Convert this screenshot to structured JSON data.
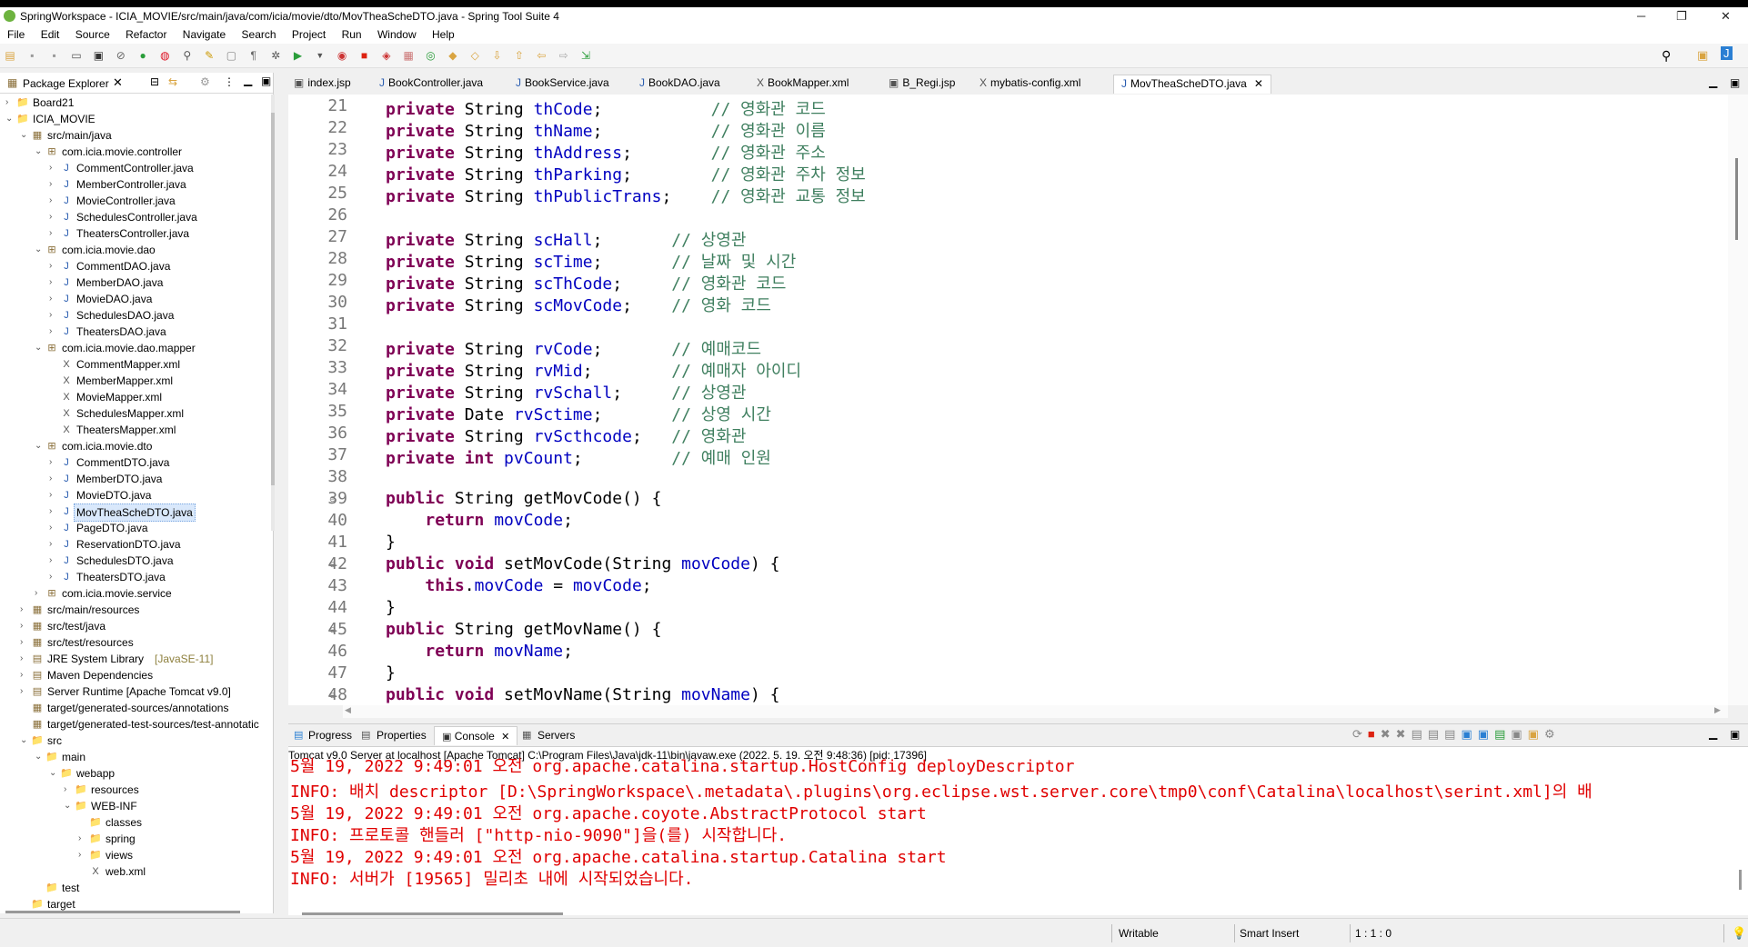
{
  "window": {
    "title": "SpringWorkspace - ICIA_MOVIE/src/main/java/com/icia/movie/dto/MovTheaScheDTO.java - Spring Tool Suite 4",
    "controls": [
      "─",
      "❐",
      "✕"
    ]
  },
  "menu": [
    "File",
    "Edit",
    "Source",
    "Refactor",
    "Navigate",
    "Search",
    "Project",
    "Run",
    "Window",
    "Help"
  ],
  "package_explorer": {
    "title": "Package Explorer",
    "tree": [
      {
        "indent": 0,
        "arrow": "›",
        "icon": "📁",
        "label": "Board21"
      },
      {
        "indent": 0,
        "arrow": "⌄",
        "icon": "📁",
        "label": "ICIA_MOVIE"
      },
      {
        "indent": 1,
        "arrow": "⌄",
        "icon": "▦",
        "label": "src/main/java"
      },
      {
        "indent": 2,
        "arrow": "⌄",
        "icon": "⊞",
        "label": "com.icia.movie.controller"
      },
      {
        "indent": 3,
        "arrow": "›",
        "icon": "J",
        "label": "CommentController.java"
      },
      {
        "indent": 3,
        "arrow": "›",
        "icon": "J",
        "label": "MemberController.java"
      },
      {
        "indent": 3,
        "arrow": "›",
        "icon": "J",
        "label": "MovieController.java"
      },
      {
        "indent": 3,
        "arrow": "›",
        "icon": "J",
        "label": "SchedulesController.java"
      },
      {
        "indent": 3,
        "arrow": "›",
        "icon": "J",
        "label": "TheatersController.java"
      },
      {
        "indent": 2,
        "arrow": "⌄",
        "icon": "⊞",
        "label": "com.icia.movie.dao"
      },
      {
        "indent": 3,
        "arrow": "›",
        "icon": "J",
        "label": "CommentDAO.java"
      },
      {
        "indent": 3,
        "arrow": "›",
        "icon": "J",
        "label": "MemberDAO.java"
      },
      {
        "indent": 3,
        "arrow": "›",
        "icon": "J",
        "label": "MovieDAO.java"
      },
      {
        "indent": 3,
        "arrow": "›",
        "icon": "J",
        "label": "SchedulesDAO.java"
      },
      {
        "indent": 3,
        "arrow": "›",
        "icon": "J",
        "label": "TheatersDAO.java"
      },
      {
        "indent": 2,
        "arrow": "⌄",
        "icon": "⊞",
        "label": "com.icia.movie.dao.mapper"
      },
      {
        "indent": 3,
        "arrow": "",
        "icon": "X",
        "label": "CommentMapper.xml"
      },
      {
        "indent": 3,
        "arrow": "",
        "icon": "X",
        "label": "MemberMapper.xml"
      },
      {
        "indent": 3,
        "arrow": "",
        "icon": "X",
        "label": "MovieMapper.xml"
      },
      {
        "indent": 3,
        "arrow": "",
        "icon": "X",
        "label": "SchedulesMapper.xml"
      },
      {
        "indent": 3,
        "arrow": "",
        "icon": "X",
        "label": "TheatersMapper.xml"
      },
      {
        "indent": 2,
        "arrow": "⌄",
        "icon": "⊞",
        "label": "com.icia.movie.dto"
      },
      {
        "indent": 3,
        "arrow": "›",
        "icon": "J",
        "label": "CommentDTO.java"
      },
      {
        "indent": 3,
        "arrow": "›",
        "icon": "J",
        "label": "MemberDTO.java"
      },
      {
        "indent": 3,
        "arrow": "›",
        "icon": "J",
        "label": "MovieDTO.java"
      },
      {
        "indent": 3,
        "arrow": "›",
        "icon": "J",
        "label": "MovTheaScheDTO.java",
        "selected": true
      },
      {
        "indent": 3,
        "arrow": "›",
        "icon": "J",
        "label": "PageDTO.java"
      },
      {
        "indent": 3,
        "arrow": "›",
        "icon": "J",
        "label": "ReservationDTO.java"
      },
      {
        "indent": 3,
        "arrow": "›",
        "icon": "J",
        "label": "SchedulesDTO.java"
      },
      {
        "indent": 3,
        "arrow": "›",
        "icon": "J",
        "label": "TheatersDTO.java"
      },
      {
        "indent": 2,
        "arrow": "›",
        "icon": "⊞",
        "label": "com.icia.movie.service"
      },
      {
        "indent": 1,
        "arrow": "›",
        "icon": "▦",
        "label": "src/main/resources"
      },
      {
        "indent": 1,
        "arrow": "›",
        "icon": "▦",
        "label": "src/test/java"
      },
      {
        "indent": 1,
        "arrow": "›",
        "icon": "▦",
        "label": "src/test/resources"
      },
      {
        "indent": 1,
        "arrow": "›",
        "icon": "▤",
        "label": "JRE System Library",
        "suffix": "[JavaSE-11]"
      },
      {
        "indent": 1,
        "arrow": "›",
        "icon": "▤",
        "label": "Maven Dependencies"
      },
      {
        "indent": 1,
        "arrow": "›",
        "icon": "▤",
        "label": "Server Runtime [Apache Tomcat v9.0]"
      },
      {
        "indent": 1,
        "arrow": "",
        "icon": "▦",
        "label": "target/generated-sources/annotations"
      },
      {
        "indent": 1,
        "arrow": "",
        "icon": "▦",
        "label": "target/generated-test-sources/test-annotatic"
      },
      {
        "indent": 1,
        "arrow": "⌄",
        "icon": "📁",
        "label": "src"
      },
      {
        "indent": 2,
        "arrow": "⌄",
        "icon": "📁",
        "label": "main"
      },
      {
        "indent": 3,
        "arrow": "⌄",
        "icon": "📁",
        "label": "webapp"
      },
      {
        "indent": 4,
        "arrow": "›",
        "icon": "📁",
        "label": "resources"
      },
      {
        "indent": 4,
        "arrow": "⌄",
        "icon": "📁",
        "label": "WEB-INF"
      },
      {
        "indent": 5,
        "arrow": "",
        "icon": "📁",
        "label": "classes"
      },
      {
        "indent": 5,
        "arrow": "›",
        "icon": "📁",
        "label": "spring"
      },
      {
        "indent": 5,
        "arrow": "›",
        "icon": "📁",
        "label": "views"
      },
      {
        "indent": 5,
        "arrow": "",
        "icon": "X",
        "label": "web.xml"
      },
      {
        "indent": 2,
        "arrow": "",
        "icon": "📁",
        "label": "test"
      },
      {
        "indent": 1,
        "arrow": "",
        "icon": "📁",
        "label": "target"
      }
    ]
  },
  "editor_tabs": [
    {
      "label": "index.jsp",
      "icon": "▣"
    },
    {
      "label": "BookController.java",
      "icon": "J"
    },
    {
      "label": "BookService.java",
      "icon": "J"
    },
    {
      "label": "BookDAO.java",
      "icon": "J"
    },
    {
      "label": "BookMapper.xml",
      "icon": "X"
    },
    {
      "label": "B_Regi.jsp",
      "icon": "▣"
    },
    {
      "label": "mybatis-config.xml",
      "icon": "X"
    },
    {
      "label": "MovTheaScheDTO.java",
      "icon": "J",
      "active": true
    }
  ],
  "code_lines": [
    {
      "n": "21",
      "segs": [
        [
          "kw",
          "private "
        ],
        [
          "",
          "String "
        ],
        [
          "fld",
          "thCode"
        ],
        [
          "",
          ";           "
        ],
        [
          "cmt",
          "// 영화관 코드"
        ]
      ]
    },
    {
      "n": "22",
      "segs": [
        [
          "kw",
          "private "
        ],
        [
          "",
          "String "
        ],
        [
          "fld",
          "thName"
        ],
        [
          "",
          ";           "
        ],
        [
          "cmt",
          "// 영화관 이름"
        ]
      ]
    },
    {
      "n": "23",
      "segs": [
        [
          "kw",
          "private "
        ],
        [
          "",
          "String "
        ],
        [
          "fld",
          "thAddress"
        ],
        [
          "",
          ";        "
        ],
        [
          "cmt",
          "// 영화관 주소"
        ]
      ]
    },
    {
      "n": "24",
      "segs": [
        [
          "kw",
          "private "
        ],
        [
          "",
          "String "
        ],
        [
          "fld",
          "thParking"
        ],
        [
          "",
          ";        "
        ],
        [
          "cmt",
          "// 영화관 주차 정보"
        ]
      ]
    },
    {
      "n": "25",
      "segs": [
        [
          "kw",
          "private "
        ],
        [
          "",
          "String "
        ],
        [
          "fld",
          "thPublicTrans"
        ],
        [
          "",
          ";    "
        ],
        [
          "cmt",
          "// 영화관 교통 정보"
        ]
      ]
    },
    {
      "n": "26",
      "segs": []
    },
    {
      "n": "27",
      "segs": [
        [
          "kw",
          "private "
        ],
        [
          "",
          "String "
        ],
        [
          "fld",
          "scHall"
        ],
        [
          "",
          ";       "
        ],
        [
          "cmt",
          "// 상영관"
        ]
      ]
    },
    {
      "n": "28",
      "segs": [
        [
          "kw",
          "private "
        ],
        [
          "",
          "String "
        ],
        [
          "fld",
          "scTime"
        ],
        [
          "",
          ";       "
        ],
        [
          "cmt",
          "// 날짜 및 시간"
        ]
      ]
    },
    {
      "n": "29",
      "segs": [
        [
          "kw",
          "private "
        ],
        [
          "",
          "String "
        ],
        [
          "fld",
          "scThCode"
        ],
        [
          "",
          ";     "
        ],
        [
          "cmt",
          "// 영화관 코드"
        ]
      ]
    },
    {
      "n": "30",
      "segs": [
        [
          "kw",
          "private "
        ],
        [
          "",
          "String "
        ],
        [
          "fld",
          "scMovCode"
        ],
        [
          "",
          ";    "
        ],
        [
          "cmt",
          "// 영화 코드"
        ]
      ]
    },
    {
      "n": "31",
      "segs": []
    },
    {
      "n": "32",
      "segs": [
        [
          "kw",
          "private "
        ],
        [
          "",
          "String "
        ],
        [
          "fld",
          "rvCode"
        ],
        [
          "",
          ";       "
        ],
        [
          "cmt",
          "// 예매코드"
        ]
      ]
    },
    {
      "n": "33",
      "segs": [
        [
          "kw",
          "private "
        ],
        [
          "",
          "String "
        ],
        [
          "fld",
          "rvMid"
        ],
        [
          "",
          ";        "
        ],
        [
          "cmt",
          "// 예매자 아이디"
        ]
      ]
    },
    {
      "n": "34",
      "segs": [
        [
          "kw",
          "private "
        ],
        [
          "",
          "String "
        ],
        [
          "fld",
          "rvSchall"
        ],
        [
          "",
          ";     "
        ],
        [
          "cmt",
          "// 상영관"
        ]
      ]
    },
    {
      "n": "35",
      "segs": [
        [
          "kw",
          "private "
        ],
        [
          "",
          "Date "
        ],
        [
          "fld",
          "rvSctime"
        ],
        [
          "",
          ";       "
        ],
        [
          "cmt",
          "// 상영 시간"
        ]
      ]
    },
    {
      "n": "36",
      "segs": [
        [
          "kw",
          "private "
        ],
        [
          "",
          "String "
        ],
        [
          "fld",
          "rvScthcode"
        ],
        [
          "",
          ";   "
        ],
        [
          "cmt",
          "// 영화관"
        ]
      ]
    },
    {
      "n": "37",
      "segs": [
        [
          "kw",
          "private int "
        ],
        [
          "fld",
          "pvCount"
        ],
        [
          "",
          ";         "
        ],
        [
          "cmt",
          "// 예매 인원"
        ]
      ]
    },
    {
      "n": "38",
      "segs": []
    },
    {
      "n": "39",
      "fold": true,
      "segs": [
        [
          "kw",
          "public "
        ],
        [
          "",
          "String getMovCode() {"
        ]
      ]
    },
    {
      "n": "40",
      "segs": [
        [
          "",
          "    "
        ],
        [
          "kw",
          "return "
        ],
        [
          "fld",
          "movCode"
        ],
        [
          "",
          ";"
        ]
      ]
    },
    {
      "n": "41",
      "segs": [
        [
          "",
          "}"
        ]
      ]
    },
    {
      "n": "42",
      "fold": true,
      "segs": [
        [
          "kw",
          "public void "
        ],
        [
          "",
          "setMovCode(String "
        ],
        [
          "fld",
          "movCode"
        ],
        [
          "",
          ") {"
        ]
      ]
    },
    {
      "n": "43",
      "segs": [
        [
          "",
          "    "
        ],
        [
          "kw",
          "this"
        ],
        [
          "",
          "."
        ],
        [
          "fld",
          "movCode"
        ],
        [
          "",
          " = "
        ],
        [
          "fld",
          "movCode"
        ],
        [
          "",
          ";"
        ]
      ]
    },
    {
      "n": "44",
      "segs": [
        [
          "",
          "}"
        ]
      ]
    },
    {
      "n": "45",
      "fold": true,
      "segs": [
        [
          "kw",
          "public "
        ],
        [
          "",
          "String getMovName() {"
        ]
      ]
    },
    {
      "n": "46",
      "segs": [
        [
          "",
          "    "
        ],
        [
          "kw",
          "return "
        ],
        [
          "fld",
          "movName"
        ],
        [
          "",
          ";"
        ]
      ]
    },
    {
      "n": "47",
      "segs": [
        [
          "",
          "}"
        ]
      ]
    },
    {
      "n": "48",
      "fold": true,
      "segs": [
        [
          "kw",
          "public void "
        ],
        [
          "",
          "setMovName(String "
        ],
        [
          "fld",
          "movName"
        ],
        [
          "",
          ") {"
        ]
      ]
    }
  ],
  "bottom_tabs": [
    {
      "label": "Progress"
    },
    {
      "label": "Properties"
    },
    {
      "label": "Console",
      "active": true
    },
    {
      "label": "Servers"
    }
  ],
  "console": {
    "header": "Tomcat v9.0 Server at localhost [Apache Tomcat] C:\\Program Files\\Java\\jdk-11\\bin\\javaw.exe  (2022. 5. 19. 오전 9:48:36) [pid: 17396]",
    "lines": [
      "5월 19, 2022 9:49:01 오전 org.apache.catalina.startup.HostConfig deployDescriptor",
      "INFO: 배치 descriptor [D:\\SpringWorkspace\\.metadata\\.plugins\\org.eclipse.wst.server.core\\tmp0\\conf\\Catalina\\localhost\\serint.xml]의 배",
      "5월 19, 2022 9:49:01 오전 org.apache.coyote.AbstractProtocol start",
      "INFO: 프로토콜 핸들러 [\"http-nio-9090\"]을(를) 시작합니다.",
      "5월 19, 2022 9:49:01 오전 org.apache.catalina.startup.Catalina start",
      "INFO: 서버가 [19565] 밀리초 내에 시작되었습니다."
    ]
  },
  "statusbar": {
    "mode": "Writable",
    "insert": "Smart Insert",
    "position": "1 : 1 : 0"
  }
}
